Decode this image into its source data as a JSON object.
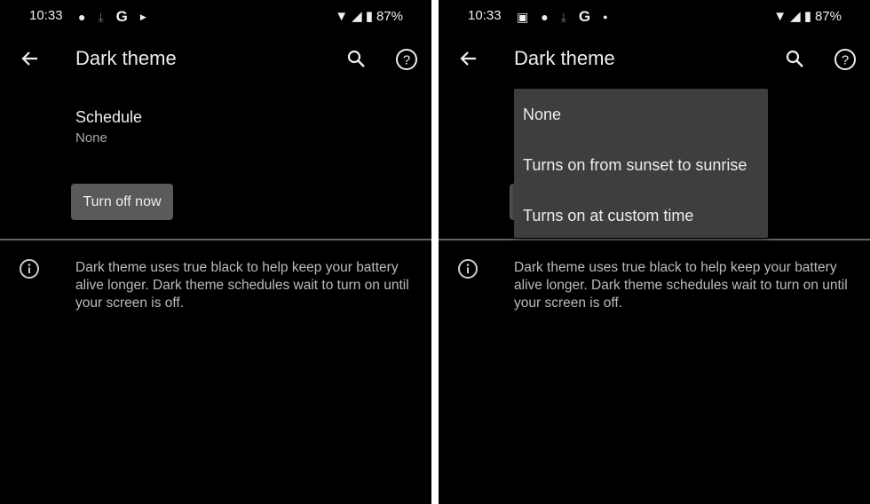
{
  "status_bar": {
    "time": "10:33",
    "battery": "87%"
  },
  "header": {
    "title": "Dark theme"
  },
  "schedule": {
    "label": "Schedule",
    "value": "None"
  },
  "button": {
    "label": "Turn off now"
  },
  "info": {
    "text": "Dark theme uses true black to help keep your battery alive longer. Dark theme schedules wait to turn on until your screen is off."
  },
  "menu": {
    "options": [
      "None",
      "Turns on from sunset to sunrise",
      "Turns on at custom time"
    ]
  }
}
